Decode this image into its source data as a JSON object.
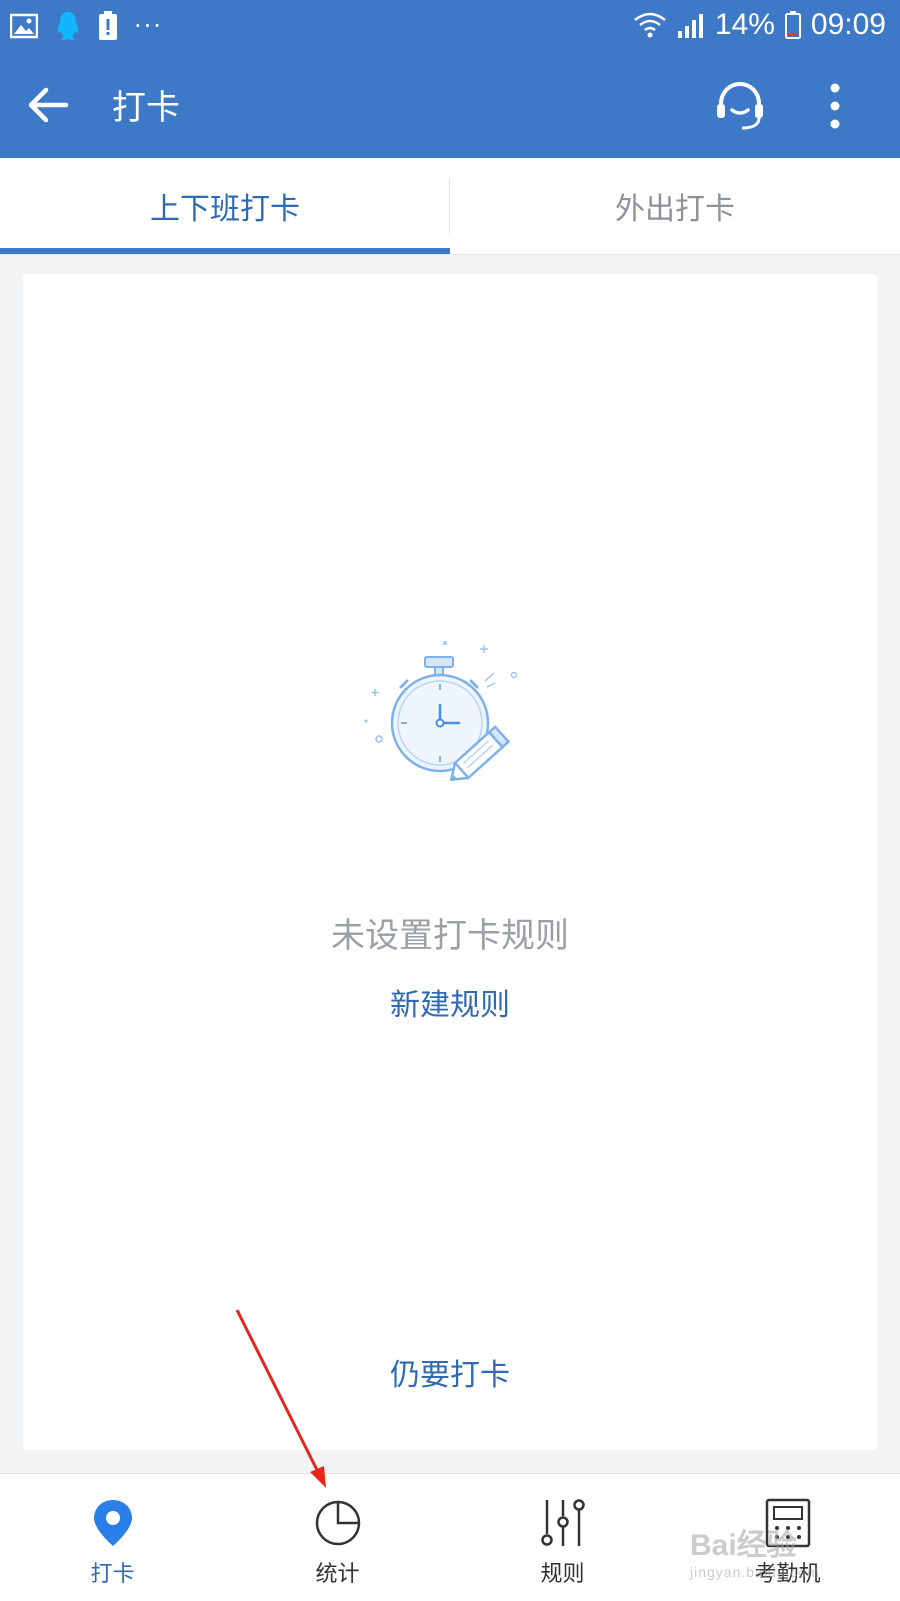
{
  "status_bar": {
    "battery_percent": "14%",
    "time": "09:09",
    "more_dots": "···"
  },
  "app_bar": {
    "title": "打卡"
  },
  "tabs": [
    {
      "label": "上下班打卡",
      "active": true
    },
    {
      "label": "外出打卡",
      "active": false
    }
  ],
  "empty_state": {
    "message": "未设置打卡规则",
    "new_rule_link": "新建规则",
    "still_clock_in_link": "仍要打卡"
  },
  "bottom_nav": [
    {
      "label": "打卡",
      "icon": "location-pin-icon",
      "active": true
    },
    {
      "label": "统计",
      "icon": "pie-chart-icon",
      "active": false
    },
    {
      "label": "规则",
      "icon": "sliders-icon",
      "active": false
    },
    {
      "label": "考勤机",
      "icon": "attendance-machine-icon",
      "active": false
    }
  ],
  "watermark": {
    "brand": "Bai经验",
    "url": "jingyan.baidu.com"
  },
  "colors": {
    "primary": "#3d79c6",
    "link": "#2f6ab5",
    "muted_text": "#9aa0a6",
    "background": "#f2f3f5"
  }
}
